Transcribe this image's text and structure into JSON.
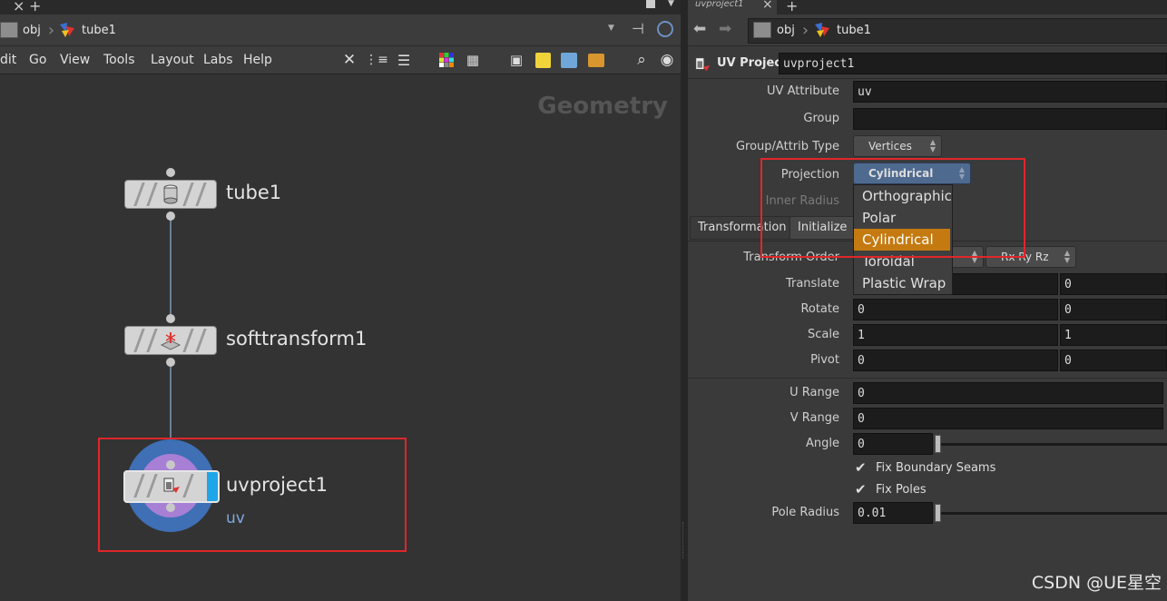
{
  "left": {
    "breadcrumb": {
      "context": "obj",
      "node": "tube1"
    },
    "menu": [
      "dit",
      "Go",
      "View",
      "Tools",
      "Layout",
      "Labs",
      "Help"
    ],
    "watermark": "Geometry",
    "nodes": [
      {
        "name": "tube1",
        "flag": ""
      },
      {
        "name": "softtransform1",
        "flag": ""
      },
      {
        "name": "uvproject1",
        "flag": "uv"
      }
    ]
  },
  "right": {
    "breadcrumb": {
      "context": "obj",
      "node": "tube1"
    },
    "tab_title": "uvproject1",
    "header": {
      "type_label": "UV Project",
      "node_name": "uvproject1"
    },
    "params": {
      "uv_attribute": {
        "label": "UV Attribute",
        "value": "uv"
      },
      "group": {
        "label": "Group",
        "value": ""
      },
      "group_type": {
        "label": "Group/Attrib Type",
        "value": "Vertices"
      },
      "projection": {
        "label": "Projection",
        "value": "Cylindrical"
      },
      "inner_radius": {
        "label": "Inner Radius"
      },
      "tabs": [
        "Transformation",
        "Initialize"
      ],
      "transform_order": {
        "label": "Transform Order",
        "rot_value": "Rx Ry Rz"
      },
      "translate": {
        "label": "Translate",
        "v2": "0"
      },
      "rotate": {
        "label": "Rotate",
        "v1": "0",
        "v2": "0"
      },
      "scale": {
        "label": "Scale",
        "v1": "1",
        "v2": "1"
      },
      "pivot": {
        "label": "Pivot",
        "v1": "0",
        "v2": "0"
      },
      "u_range": {
        "label": "U Range",
        "v1": "0"
      },
      "v_range": {
        "label": "V Range",
        "v1": "0"
      },
      "angle": {
        "label": "Angle",
        "value": "0"
      },
      "fix_seams": {
        "label": "Fix Boundary Seams",
        "checked": true
      },
      "fix_poles": {
        "label": "Fix Poles",
        "checked": true
      },
      "pole_radius": {
        "label": "Pole Radius",
        "value": "0.01"
      }
    },
    "projection_menu": {
      "items": [
        "Orthographic",
        "Polar",
        "Cylindrical",
        "Toroidal",
        "Plastic Wrap"
      ],
      "selected": "Cylindrical"
    }
  },
  "credit": "CSDN @UE星空",
  "colors": {
    "highlight_red": "#e0262a",
    "menu_selected": "#c47a10",
    "selected_node_ring": "#3f6fb5"
  }
}
